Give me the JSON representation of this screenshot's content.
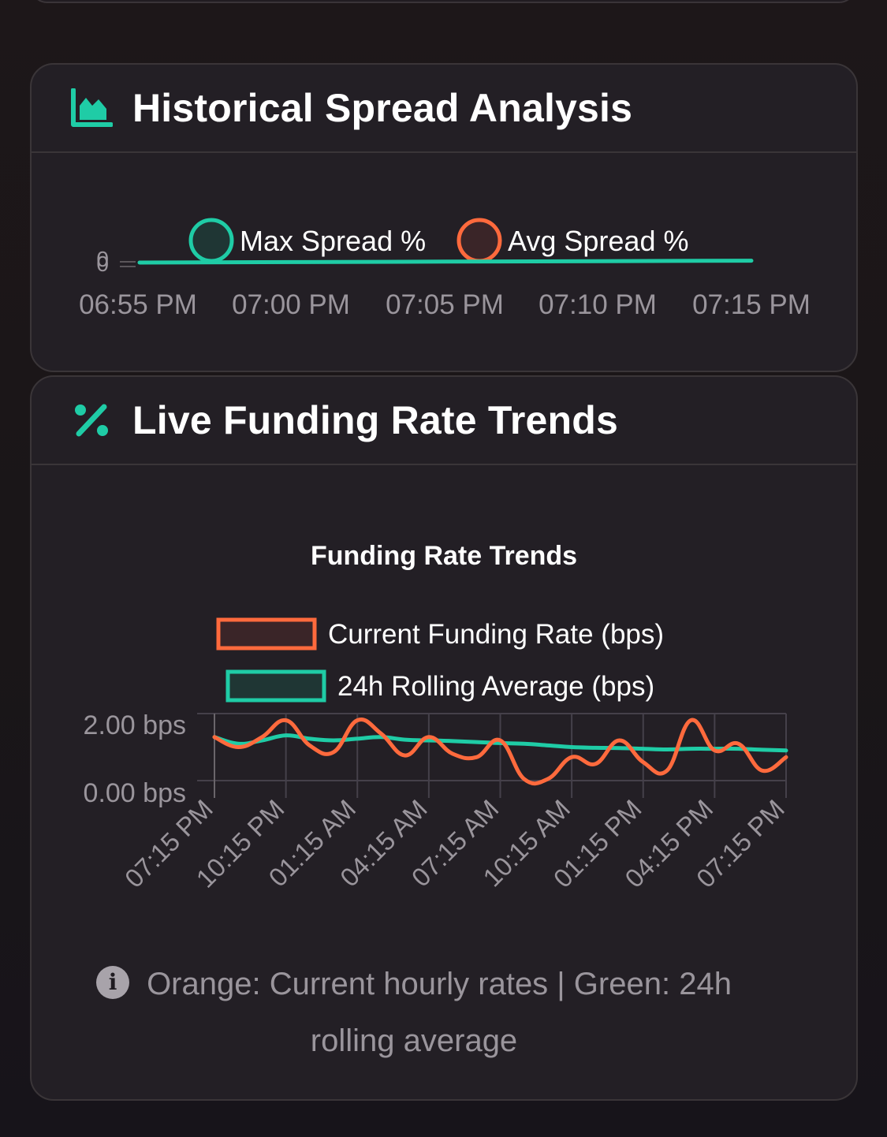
{
  "colors": {
    "accent_green": "#1fcca6",
    "accent_orange": "#ff6a3d",
    "card_bg": "#231f25",
    "border": "#3a3538",
    "muted_text": "#9a959c"
  },
  "spread_card": {
    "icon": "area-chart-icon",
    "title": "Historical Spread Analysis",
    "chart_data": {
      "type": "line",
      "legend": [
        "Max Spread %",
        "Avg Spread %"
      ],
      "y_tick_label": "0",
      "x_ticks": [
        "06:55 PM",
        "07:00 PM",
        "07:05 PM",
        "07:10 PM",
        "07:15 PM"
      ],
      "series": [
        {
          "name": "Max Spread %",
          "color": "#1fcca6",
          "values": [
            0,
            0,
            0,
            0,
            0
          ]
        },
        {
          "name": "Avg Spread %",
          "color": "#ff6a3d",
          "values": [
            0,
            0,
            0,
            0,
            0
          ]
        }
      ],
      "legend_placement": "top"
    }
  },
  "funding_card": {
    "icon": "percent-icon",
    "title": "Live Funding Rate Trends",
    "chart_data": {
      "type": "line",
      "title": "Funding Rate Trends",
      "legend": [
        "Current Funding Rate (bps)",
        "24h Rolling Average (bps)"
      ],
      "legend_placement": "top",
      "y_ticks": [
        "2.00 bps",
        "0.00 bps"
      ],
      "y_tick_values": [
        2,
        0
      ],
      "ylim": [
        0,
        2
      ],
      "x_ticks": [
        "07:15 PM",
        "10:15 PM",
        "01:15 AM",
        "04:15 AM",
        "07:15 AM",
        "10:15 AM",
        "01:15 PM",
        "04:15 PM",
        "07:15 PM"
      ],
      "grid": true,
      "series": [
        {
          "name": "Current Funding Rate (bps)",
          "color": "#ff6a3d",
          "values": [
            1.3,
            1.0,
            1.3,
            1.8,
            1.05,
            0.85,
            1.8,
            1.4,
            0.75,
            1.3,
            0.8,
            0.7,
            1.2,
            0.05,
            0.05,
            0.7,
            0.5,
            1.2,
            0.55,
            0.3,
            1.8,
            0.9,
            1.1,
            0.3,
            0.7
          ]
        },
        {
          "name": "24h Rolling Average (bps)",
          "color": "#1fcca6",
          "values": [
            1.3,
            1.1,
            1.2,
            1.35,
            1.25,
            1.2,
            1.25,
            1.3,
            1.22,
            1.2,
            1.18,
            1.15,
            1.12,
            1.1,
            1.05,
            1.0,
            0.98,
            0.97,
            0.95,
            0.93,
            0.95,
            0.95,
            0.95,
            0.92,
            0.9
          ]
        }
      ]
    }
  },
  "note": {
    "text": "Orange: Current hourly rates | Green: 24h rolling average"
  }
}
